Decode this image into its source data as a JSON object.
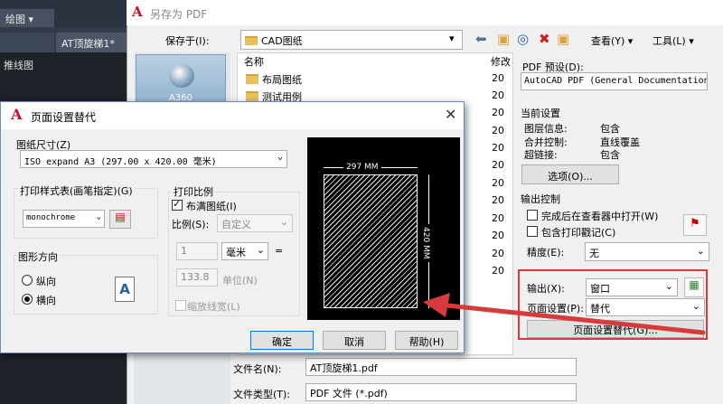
{
  "cad": {
    "dropdown": "绘图",
    "tab": "AT顶旋梯1*",
    "layer_text": "推线图"
  },
  "saveas": {
    "title": "另存为 PDF",
    "save_in_label": "保存于(I):",
    "save_in_value": "CAD图纸",
    "view_menu": "查看(Y)",
    "tools_menu": "工具(L)",
    "places": [
      {
        "label": "A360"
      }
    ],
    "columns": {
      "name": "名称",
      "modified": "修改"
    },
    "files": [
      {
        "name": "布局图纸"
      },
      {
        "name": "测试用例"
      }
    ],
    "modified_prefix": [
      "20",
      "20",
      "20",
      "20",
      "20",
      "20",
      "20",
      "20",
      "20",
      "20",
      "20",
      "20"
    ],
    "file_name_label": "文件名(N):",
    "file_name_value": "AT顶旋梯1.pdf",
    "file_type_label": "文件类型(T):",
    "file_type_value": "PDF 文件 (*.pdf)"
  },
  "pdf_options": {
    "preset_label": "PDF 预设(D):",
    "preset_value": "AutoCAD PDF (General Documentation)",
    "current_settings_label": "当前设置",
    "settings": [
      {
        "key": "图层信息:",
        "value": "包含"
      },
      {
        "key": "合并控制:",
        "value": "直线覆盖"
      },
      {
        "key": "超链接:",
        "value": "包含"
      }
    ],
    "options_button": "选项(O)...",
    "output_control_label": "输出控制",
    "open_in_viewer": "完成后在查看器中打开(W)",
    "include_stamp": "包含打印戳记(C)",
    "precision_label": "精度(E):",
    "precision_value": "无",
    "output_label": "输出(X):",
    "output_value": "窗口",
    "page_setup_label": "页面设置(P):",
    "page_setup_value": "替代",
    "override_button": "页面设置替代(G)..."
  },
  "dialog": {
    "title": "页面设置替代",
    "paper_size_label": "图纸尺寸(Z)",
    "paper_size_value": "ISO expand A3 (297.00 x 420.00 毫米)",
    "style_table_label": "打印样式表(画笔指定)(G)",
    "style_table_value": "monochrome",
    "orientation_label": "图形方向",
    "portrait": "纵向",
    "landscape": "横向",
    "orientation_selected": "横向",
    "orientation_icon": "A",
    "scale_label": "打印比例",
    "fit_to_paper": "布满图纸(I)",
    "fit_to_paper_checked": true,
    "ratio_label": "比例(S):",
    "ratio_value": "自定义",
    "scale_num1": "1",
    "scale_unit": "毫米",
    "scale_equals": "=",
    "scale_num2": "133.8",
    "scale_unit2": "单位(N)",
    "scale_lineweights": "缩放线宽(L)",
    "preview_width": "297 MM",
    "preview_height": "420 MM",
    "ok": "确定",
    "cancel": "取消",
    "help": "帮助(H)"
  },
  "colors": {
    "highlight": "#d43b3b",
    "autocad_red": "#c8102e"
  }
}
